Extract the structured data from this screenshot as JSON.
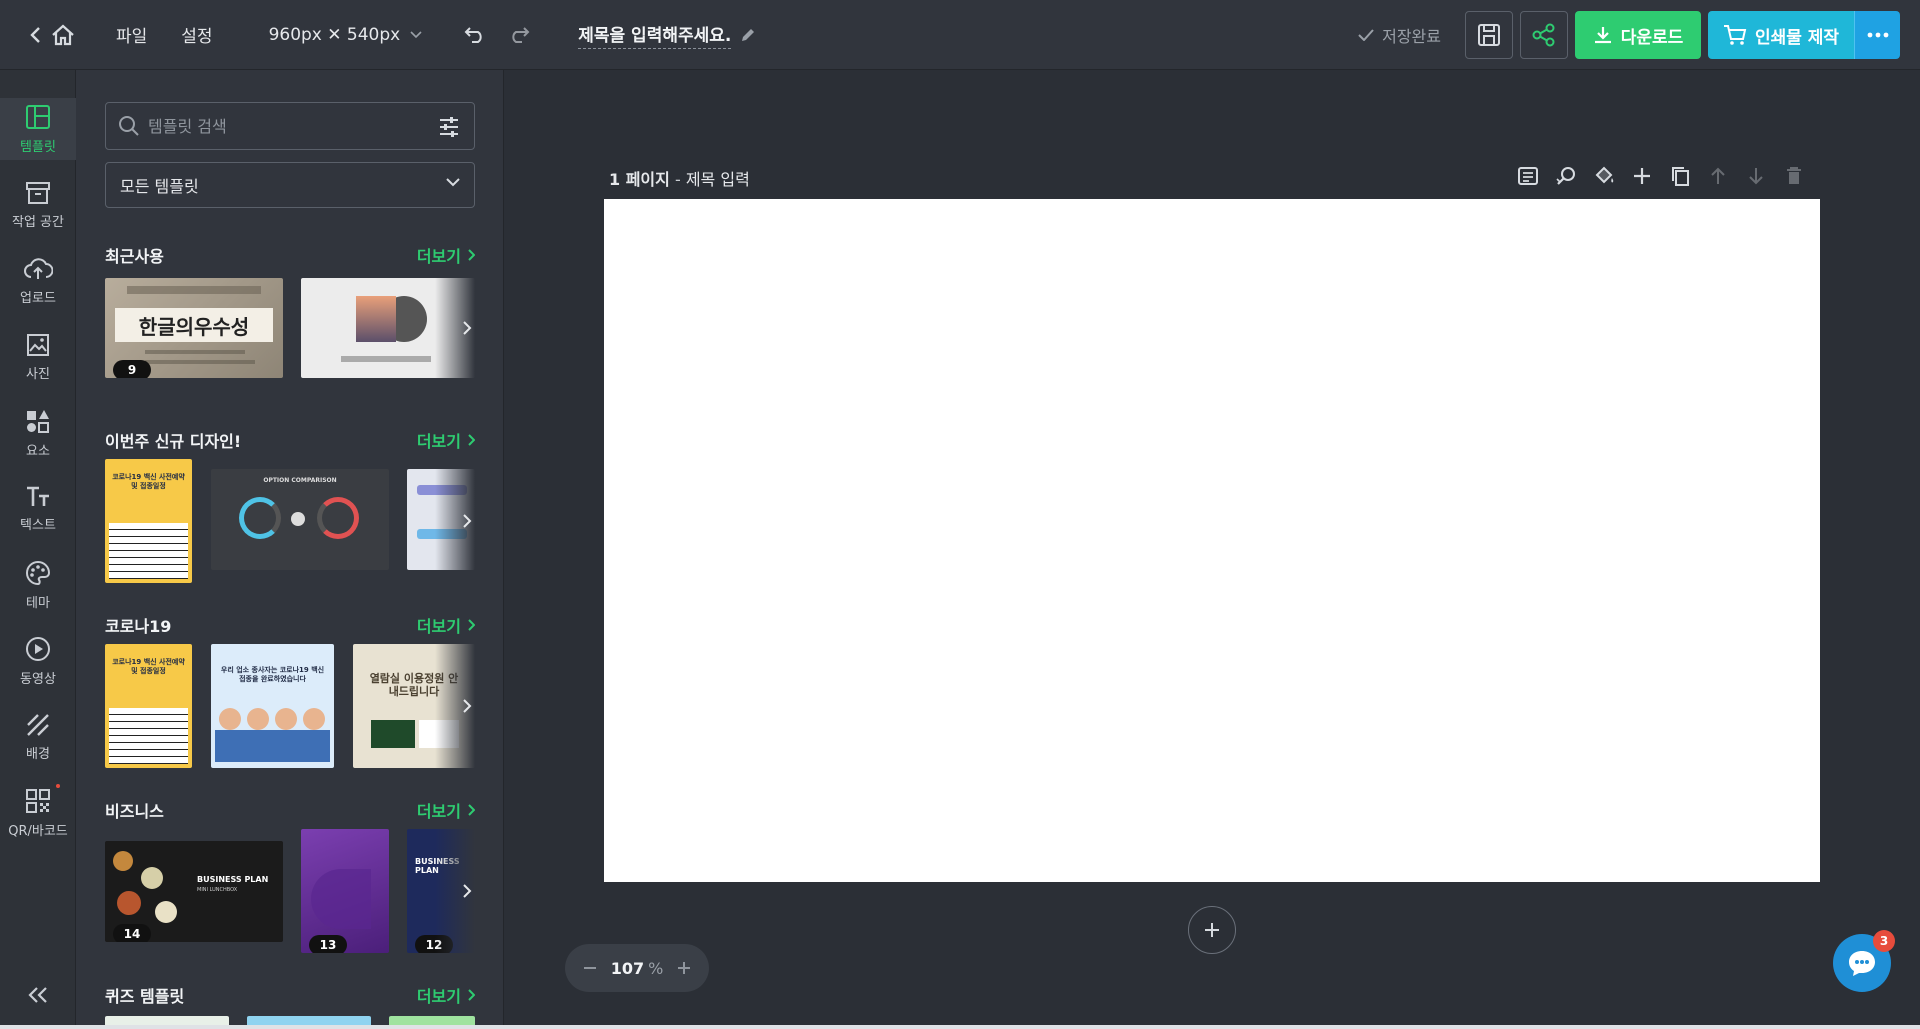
{
  "topbar": {
    "file_menu": "파일",
    "settings_menu": "설정",
    "canvas_size": "960px ✕ 540px",
    "doc_title": "제목을 입력해주세요.",
    "save_status": "저장완료",
    "download_label": "다운로드",
    "print_label": "인쇄물 제작"
  },
  "rail": {
    "items": [
      {
        "label": "템플릿",
        "icon": "template-icon"
      },
      {
        "label": "작업 공간",
        "icon": "workspace-icon"
      },
      {
        "label": "업로드",
        "icon": "upload-icon"
      },
      {
        "label": "사진",
        "icon": "photo-icon"
      },
      {
        "label": "요소",
        "icon": "elements-icon"
      },
      {
        "label": "텍스트",
        "icon": "text-icon"
      },
      {
        "label": "테마",
        "icon": "palette-icon"
      },
      {
        "label": "동영상",
        "icon": "video-icon"
      },
      {
        "label": "배경",
        "icon": "background-icon"
      },
      {
        "label": "QR/바코드",
        "icon": "qr-icon"
      }
    ]
  },
  "panel": {
    "search_placeholder": "템플릿 검색",
    "filter_label": "모든 템플릿",
    "more_label": "더보기",
    "sections": [
      {
        "title": "최근사용",
        "badges": [
          "9"
        ]
      },
      {
        "title": "이번주 신규 디자인!",
        "badges": []
      },
      {
        "title": "코로나19",
        "badges": []
      },
      {
        "title": "비즈니스",
        "badges": [
          "14",
          "13",
          "12"
        ]
      },
      {
        "title": "퀴즈 템플릿",
        "badges": []
      }
    ],
    "thumb_texts": {
      "hangul": "한글의우수성",
      "option": "OPTION COMPARISON",
      "corona_notice": "코로나19 백신 사전예약 및 접종일정",
      "staff": "우리 업소 종사자는 코로나19 백신접종을 완료하였습니다",
      "reading_room": "열람실 이용정원 안내드립니다",
      "biz_plan": "BUSINESS PLAN",
      "biz_sub": "MINI LUNCHBOX"
    }
  },
  "workspace": {
    "page_number": "1 페이지",
    "page_title_placeholder": "제목 입력",
    "zoom_value": "107",
    "zoom_unit": "%",
    "chat_badge": "3"
  },
  "colors": {
    "accent_green": "#2ecc71",
    "accent_cyan": "#1fb7d8",
    "accent_blue": "#1fa2e3"
  }
}
